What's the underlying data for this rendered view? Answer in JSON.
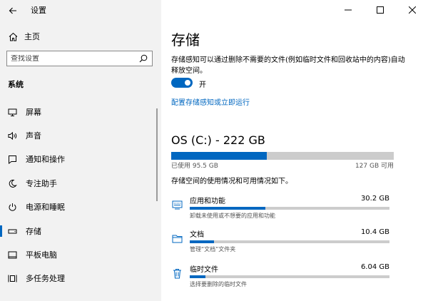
{
  "app": {
    "title": "设置"
  },
  "window_controls": {
    "minimize": "—",
    "maximize": "☐",
    "close": "✕"
  },
  "sidebar": {
    "home_label": "主页",
    "search_placeholder": "查找设置",
    "section": "系统",
    "items": [
      {
        "label": "屏幕",
        "icon": "display-icon"
      },
      {
        "label": "声音",
        "icon": "speaker-icon"
      },
      {
        "label": "通知和操作",
        "icon": "notification-icon"
      },
      {
        "label": "专注助手",
        "icon": "moon-icon"
      },
      {
        "label": "电源和睡眠",
        "icon": "power-icon"
      },
      {
        "label": "存储",
        "icon": "storage-icon",
        "active": true
      },
      {
        "label": "平板电脑",
        "icon": "tablet-icon"
      },
      {
        "label": "多任务处理",
        "icon": "multitask-icon"
      }
    ]
  },
  "main": {
    "title": "存储",
    "description": "存储感知可以通过删除不需要的文件(例如临时文件和回收站中的内容)自动释放空间。",
    "toggle_label": "开",
    "toggle_on": true,
    "link": "配置存储感知或立即运行",
    "drive": {
      "title": "OS (C:) - 222 GB",
      "used": "已使用 95.5 GB",
      "available": "127 GB 可用",
      "used_fraction": 0.43
    },
    "usage_description": "存储空间的使用情况和可用情况如下。",
    "categories": [
      {
        "name": "应用和功能",
        "size": "30.2 GB",
        "sub": "卸载未使用或不想要的应用和功能",
        "fraction": 0.38,
        "icon": "apps-icon"
      },
      {
        "name": "文档",
        "size": "10.4 GB",
        "sub": "管理“文档”文件夹",
        "fraction": 0.12,
        "icon": "folder-icon"
      },
      {
        "name": "临时文件",
        "size": "6.04 GB",
        "sub": "选择要删除的临时文件",
        "fraction": 0.08,
        "icon": "trash-icon"
      }
    ]
  },
  "accent_color": "#0067c0"
}
